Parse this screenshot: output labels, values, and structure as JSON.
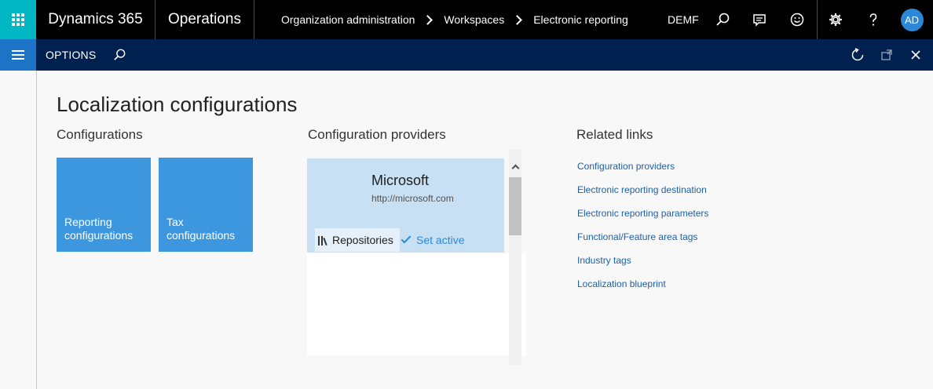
{
  "header": {
    "app_name": "Dynamics 365",
    "module": "Operations",
    "breadcrumb": [
      "Organization administration",
      "Workspaces",
      "Electronic reporting"
    ],
    "company": "DEMF",
    "user_initials": "AD"
  },
  "action_pane": {
    "options_label": "OPTIONS"
  },
  "page": {
    "title": "Localization configurations"
  },
  "configurations": {
    "heading": "Configurations",
    "tiles": [
      {
        "label": "Reporting configurations"
      },
      {
        "label": "Tax configurations"
      }
    ]
  },
  "providers": {
    "heading": "Configuration providers",
    "items": [
      {
        "name": "Microsoft",
        "url": "http://microsoft.com",
        "repositories_label": "Repositories",
        "set_active_label": "Set active"
      }
    ]
  },
  "related_links": {
    "heading": "Related links",
    "items": [
      "Configuration providers",
      "Electronic reporting destination",
      "Electronic reporting parameters",
      "Functional/Feature area tags",
      "Industry tags",
      "Localization blueprint"
    ]
  },
  "colors": {
    "topbar": "#000000",
    "waffle": "#00b7c3",
    "actionbar": "#002050",
    "tile": "#3c97df",
    "provider_selected": "#c7e0f4",
    "link": "#1d5fa6"
  }
}
